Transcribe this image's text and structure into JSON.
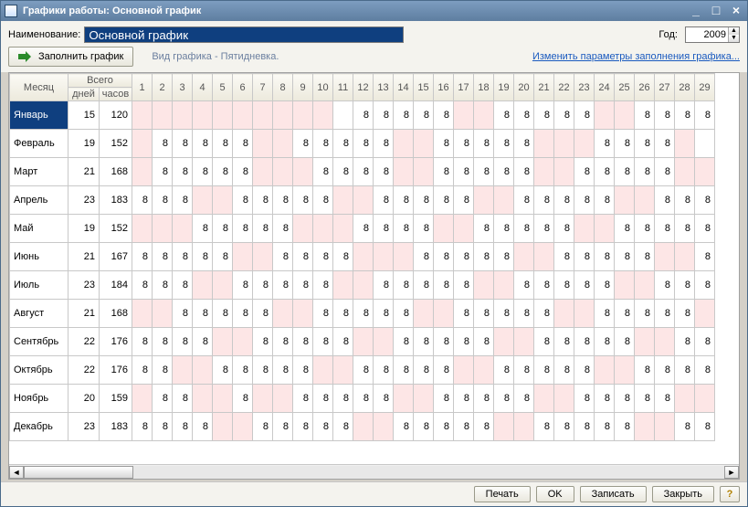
{
  "window": {
    "title": "Графики работы: Основной график"
  },
  "form": {
    "name_label": "Наименование:",
    "name_value": "Основной график",
    "year_label": "Год:",
    "year_value": "2009"
  },
  "toolbar": {
    "fill_label": "Заполнить график",
    "type_text": "Вид графика - Пятидневка.",
    "change_link": "Изменить параметры заполнения графика..."
  },
  "table": {
    "headers": {
      "month": "Месяц",
      "total": "Всего",
      "days": "дней",
      "hours": "часов"
    },
    "day_numbers": [
      1,
      2,
      3,
      4,
      5,
      6,
      7,
      8,
      9,
      10,
      11,
      12,
      13,
      14,
      15,
      16,
      17,
      18,
      19,
      20,
      21,
      22,
      23,
      24,
      25,
      26,
      27,
      28,
      29
    ],
    "months": [
      {
        "name": "Январь",
        "days": 15,
        "hours": 120,
        "selected": true,
        "cells": [
          "w",
          "w",
          "w",
          "w",
          "w",
          "w",
          "w",
          "w",
          "w",
          "w",
          null,
          8,
          8,
          8,
          8,
          8,
          "w",
          "w",
          8,
          8,
          8,
          8,
          8,
          "w",
          "w",
          8,
          8,
          8,
          8
        ]
      },
      {
        "name": "Февраль",
        "days": 19,
        "hours": 152,
        "cells": [
          "w",
          8,
          8,
          8,
          8,
          8,
          "w",
          "w",
          8,
          8,
          8,
          8,
          8,
          "w",
          "w",
          8,
          8,
          8,
          8,
          8,
          "w",
          "w",
          "w",
          8,
          8,
          8,
          8,
          "w",
          null
        ]
      },
      {
        "name": "Март",
        "days": 21,
        "hours": 168,
        "cells": [
          "w",
          8,
          8,
          8,
          8,
          8,
          "w",
          "w",
          "w",
          8,
          8,
          8,
          8,
          "w",
          "w",
          8,
          8,
          8,
          8,
          8,
          "w",
          "w",
          8,
          8,
          8,
          8,
          8,
          "w",
          "w"
        ]
      },
      {
        "name": "Апрель",
        "days": 23,
        "hours": 183,
        "cells": [
          8,
          8,
          8,
          "w",
          "w",
          8,
          8,
          8,
          8,
          8,
          "w",
          "w",
          8,
          8,
          8,
          8,
          8,
          "w",
          "w",
          8,
          8,
          8,
          8,
          8,
          "w",
          "w",
          8,
          8,
          8
        ]
      },
      {
        "name": "Май",
        "days": 19,
        "hours": 152,
        "cells": [
          "w",
          "w",
          "w",
          8,
          8,
          8,
          8,
          8,
          "w",
          "w",
          "w",
          8,
          8,
          8,
          8,
          "w",
          "w",
          8,
          8,
          8,
          8,
          8,
          "w",
          "w",
          8,
          8,
          8,
          8,
          8
        ]
      },
      {
        "name": "Июнь",
        "days": 21,
        "hours": 167,
        "cells": [
          8,
          8,
          8,
          8,
          8,
          "w",
          "w",
          8,
          8,
          8,
          8,
          "w",
          "w",
          "w",
          8,
          8,
          8,
          8,
          8,
          "w",
          "w",
          8,
          8,
          8,
          8,
          8,
          "w",
          "w",
          8
        ]
      },
      {
        "name": "Июль",
        "days": 23,
        "hours": 184,
        "cells": [
          8,
          8,
          8,
          "w",
          "w",
          8,
          8,
          8,
          8,
          8,
          "w",
          "w",
          8,
          8,
          8,
          8,
          8,
          "w",
          "w",
          8,
          8,
          8,
          8,
          8,
          "w",
          "w",
          8,
          8,
          8
        ]
      },
      {
        "name": "Август",
        "days": 21,
        "hours": 168,
        "cells": [
          "w",
          "w",
          8,
          8,
          8,
          8,
          8,
          "w",
          "w",
          8,
          8,
          8,
          8,
          8,
          "w",
          "w",
          8,
          8,
          8,
          8,
          8,
          "w",
          "w",
          8,
          8,
          8,
          8,
          8,
          "w"
        ]
      },
      {
        "name": "Сентябрь",
        "days": 22,
        "hours": 176,
        "cells": [
          8,
          8,
          8,
          8,
          "w",
          "w",
          8,
          8,
          8,
          8,
          8,
          "w",
          "w",
          8,
          8,
          8,
          8,
          8,
          "w",
          "w",
          8,
          8,
          8,
          8,
          8,
          "w",
          "w",
          8,
          8
        ]
      },
      {
        "name": "Октябрь",
        "days": 22,
        "hours": 176,
        "cells": [
          8,
          8,
          "w",
          "w",
          8,
          8,
          8,
          8,
          8,
          "w",
          "w",
          8,
          8,
          8,
          8,
          8,
          "w",
          "w",
          8,
          8,
          8,
          8,
          8,
          "w",
          "w",
          8,
          8,
          8,
          8
        ]
      },
      {
        "name": "Ноябрь",
        "days": 20,
        "hours": 159,
        "cells": [
          "w",
          8,
          8,
          "w",
          "w",
          8,
          "w",
          "w",
          8,
          8,
          8,
          8,
          8,
          "w",
          "w",
          8,
          8,
          8,
          8,
          8,
          "w",
          "w",
          8,
          8,
          8,
          8,
          8,
          "w",
          "w"
        ]
      },
      {
        "name": "Декабрь",
        "days": 23,
        "hours": 183,
        "cells": [
          8,
          8,
          8,
          8,
          "w",
          "w",
          8,
          8,
          8,
          8,
          8,
          "w",
          "w",
          8,
          8,
          8,
          8,
          8,
          "w",
          "w",
          8,
          8,
          8,
          8,
          8,
          "w",
          "w",
          8,
          8
        ]
      }
    ]
  },
  "footer": {
    "print": "Печать",
    "ok": "OK",
    "save": "Записать",
    "close": "Закрыть"
  }
}
